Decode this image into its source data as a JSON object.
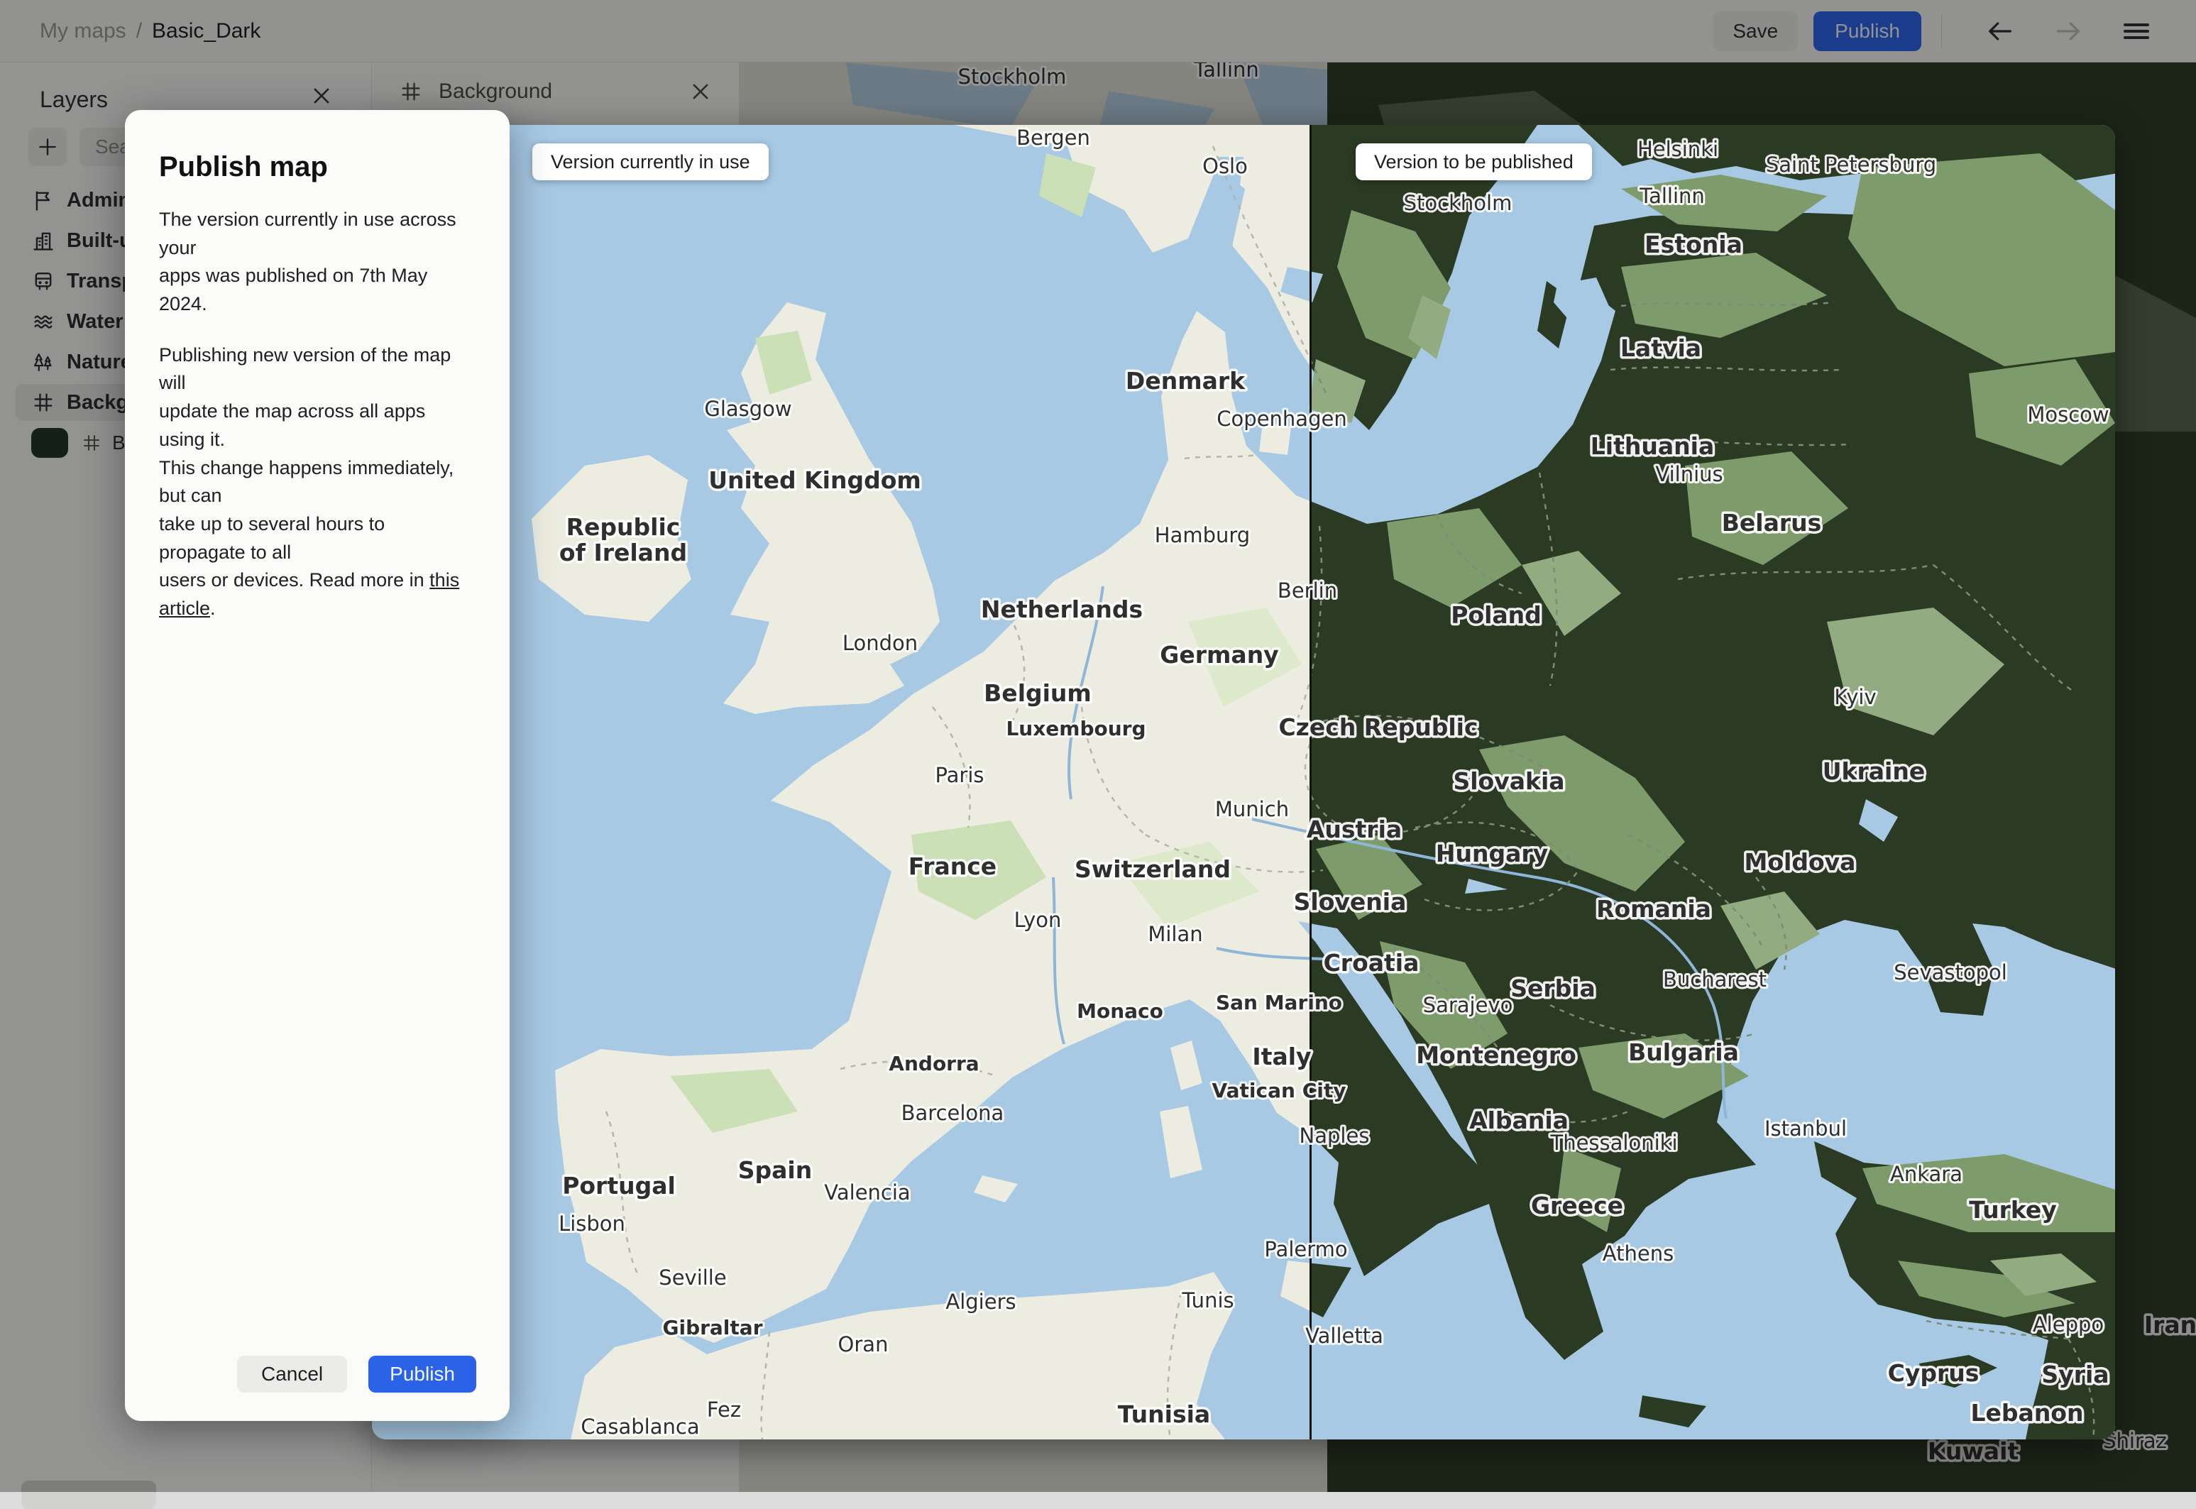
{
  "topbar": {
    "my_maps": "My maps",
    "sep": "/",
    "map_name": "Basic_Dark",
    "save": "Save",
    "publish": "Publish",
    "back_icon": "arrow-left-icon",
    "forward_icon": "arrow-right-icon",
    "menu_icon": "hamburger-icon"
  },
  "sidebar": {
    "title": "Layers",
    "search_placeholder": "Search",
    "items": [
      {
        "label": "Administrative",
        "icon": "flag-icon",
        "selected": false
      },
      {
        "label": "Built-up",
        "icon": "building-icon",
        "selected": false
      },
      {
        "label": "Transport",
        "icon": "bus-icon",
        "selected": false
      },
      {
        "label": "Water",
        "icon": "waves-icon",
        "selected": false
      },
      {
        "label": "Nature",
        "icon": "trees-icon",
        "selected": false
      },
      {
        "label": "Background",
        "icon": "frame-icon",
        "selected": true
      }
    ],
    "sublayer": {
      "label": "Background",
      "swatch_color": "#1E3526"
    }
  },
  "tab": {
    "title": "Background"
  },
  "compare": {
    "left_badge": "Version currently in use",
    "right_badge": "Version to be published"
  },
  "modal": {
    "title": "Publish map",
    "p1": "The version currently in use across your\napps was published on 7th May 2024.",
    "p2": "Publishing new version of the map will\nupdate the map across all apps using it.\nThis change happens immediately, but can\ntake up to several hours to propagate to all\nusers or devices. Read more in ",
    "link": "this article",
    "suffix": ".",
    "cancel": "Cancel",
    "publish": "Publish"
  },
  "map": {
    "labels": [
      [
        "Bergen",
        960,
        28,
        "c"
      ],
      [
        "Oslo",
        1202,
        68,
        "c"
      ],
      [
        "Glasgow",
        530,
        410,
        "c"
      ],
      [
        "United Kingdom",
        624,
        512,
        "C"
      ],
      [
        "Republic",
        354,
        578,
        "C"
      ],
      [
        "of Ireland",
        354,
        614,
        "C"
      ],
      [
        "London",
        716,
        740,
        "c"
      ],
      [
        "Denmark",
        1146,
        372,
        "C"
      ],
      [
        "Copenhagen",
        1282,
        424,
        "c"
      ],
      [
        "Hamburg",
        1170,
        588,
        "c"
      ],
      [
        "Netherlands",
        972,
        694,
        "C"
      ],
      [
        "Berlin",
        1318,
        666,
        "c"
      ],
      [
        "Germany",
        1194,
        758,
        "C"
      ],
      [
        "Belgium",
        938,
        812,
        "C"
      ],
      [
        "Luxembourg",
        992,
        860,
        "s"
      ],
      [
        "Paris",
        828,
        926,
        "c"
      ],
      [
        "France",
        818,
        1056,
        "C"
      ],
      [
        "Munich",
        1240,
        974,
        "c"
      ],
      [
        "Switzerland",
        1100,
        1060,
        "C"
      ],
      [
        "Lyon",
        938,
        1130,
        "c"
      ],
      [
        "Milan",
        1132,
        1150,
        "c"
      ],
      [
        "Monaco",
        1054,
        1258,
        "s"
      ],
      [
        "San Marino",
        1278,
        1246,
        "s"
      ],
      [
        "Italy",
        1282,
        1324,
        "C"
      ],
      [
        "Vatican City",
        1278,
        1370,
        "s"
      ],
      [
        "Andorra",
        792,
        1332,
        "s"
      ],
      [
        "Barcelona",
        818,
        1402,
        "c"
      ],
      [
        "Spain",
        568,
        1484,
        "C"
      ],
      [
        "Valencia",
        698,
        1514,
        "c"
      ],
      [
        "Portugal",
        348,
        1506,
        "C"
      ],
      [
        "Lisbon",
        310,
        1558,
        "c"
      ],
      [
        "Seville",
        452,
        1634,
        "c"
      ],
      [
        "Gibraltar",
        480,
        1704,
        "s"
      ],
      [
        "Algiers",
        858,
        1668,
        "c"
      ],
      [
        "Oran",
        692,
        1728,
        "c"
      ],
      [
        "Tunis",
        1178,
        1666,
        "c"
      ],
      [
        "Tunisia",
        1116,
        1828,
        "C"
      ],
      [
        "Fez",
        496,
        1820,
        "c"
      ],
      [
        "Casablanca",
        378,
        1844,
        "c"
      ],
      [
        "Palermo",
        1316,
        1594,
        "c"
      ],
      [
        "Naples",
        1356,
        1434,
        "c"
      ],
      [
        "Valletta",
        1370,
        1716,
        "c"
      ],
      [
        "Helsinki",
        1840,
        44,
        "c"
      ],
      [
        "Saint Petersburg",
        2084,
        66,
        "c"
      ],
      [
        "Tallinn",
        1832,
        110,
        "c"
      ],
      [
        "Stockholm",
        1530,
        120,
        "c"
      ],
      [
        "Estonia",
        1862,
        180,
        "C"
      ],
      [
        "Latvia",
        1816,
        326,
        "C"
      ],
      [
        "Moscow",
        2390,
        418,
        "c"
      ],
      [
        "Lithuania",
        1804,
        464,
        "C"
      ],
      [
        "Vilnius",
        1856,
        502,
        "c"
      ],
      [
        "Belarus",
        1972,
        572,
        "C"
      ],
      [
        "Poland",
        1584,
        702,
        "C"
      ],
      [
        "Kyiv",
        2090,
        816,
        "c"
      ],
      [
        "Czech Republic",
        1418,
        860,
        "C"
      ],
      [
        "Ukraine",
        2116,
        922,
        "C"
      ],
      [
        "Slovakia",
        1602,
        936,
        "C"
      ],
      [
        "Austria",
        1384,
        1004,
        "C"
      ],
      [
        "Hungary",
        1578,
        1038,
        "C"
      ],
      [
        "Moldova",
        2012,
        1050,
        "C"
      ],
      [
        "Slovenia",
        1378,
        1106,
        "C"
      ],
      [
        "Romania",
        1806,
        1116,
        "C"
      ],
      [
        "Croatia",
        1408,
        1192,
        "C"
      ],
      [
        "Sevastopol",
        2224,
        1204,
        "c"
      ],
      [
        "Bucharest",
        1892,
        1214,
        "c"
      ],
      [
        "Serbia",
        1664,
        1228,
        "C"
      ],
      [
        "Sarajevo",
        1544,
        1250,
        "c"
      ],
      [
        "Montenegro",
        1584,
        1322,
        "C"
      ],
      [
        "Bulgaria",
        1848,
        1318,
        "C"
      ],
      [
        "Albania",
        1616,
        1414,
        "C"
      ],
      [
        "Istanbul",
        2020,
        1424,
        "c"
      ],
      [
        "Thessaloniki",
        1750,
        1444,
        "c"
      ],
      [
        "Greece",
        1698,
        1534,
        "C"
      ],
      [
        "Athens",
        1784,
        1600,
        "c"
      ],
      [
        "Ankara",
        2190,
        1488,
        "c"
      ],
      [
        "Turkey",
        2312,
        1540,
        "C"
      ],
      [
        "Cyprus",
        2200,
        1770,
        "C"
      ],
      [
        "Aleppo",
        2390,
        1700,
        "c"
      ],
      [
        "Syria",
        2400,
        1772,
        "C"
      ],
      [
        "Lebanon",
        2332,
        1826,
        "C"
      ]
    ]
  },
  "background": {
    "labels": [
      [
        "Stockholm",
        384,
        30,
        "c"
      ],
      [
        "Tallinn",
        686,
        20,
        "c"
      ],
      [
        "Iran",
        2016,
        1790,
        "C"
      ],
      [
        "Shiraz",
        1966,
        1952,
        "c"
      ],
      [
        "Kuwait",
        1738,
        1968,
        "C"
      ]
    ]
  },
  "colors": {
    "accent": "#2A63E8",
    "topbar_bg": "#F6F6F4",
    "panel_bg": "#F8F8F6",
    "sea": "#A7C9E4",
    "land_light": "#ECEDE0",
    "land_dark": "#2B3A23",
    "patch_a_light": "#CBE0B6",
    "patch_b_light": "#DCE9CB",
    "patch_a_dark": "#7E9C6B",
    "patch_b_dark": "#93AB80",
    "border_light": "#B5B5AC",
    "border_dark": "#7E8B76",
    "river": "#8FB6D8",
    "bg_light": "#DFE1D6",
    "bg_dark": "#2B3A23",
    "divider": "#141414",
    "label": "#2F2F2F",
    "swatch": "#1E3526"
  }
}
